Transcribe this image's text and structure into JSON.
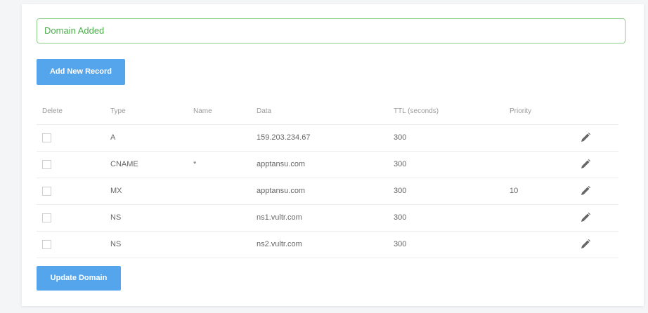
{
  "alert": {
    "text": "Domain Added"
  },
  "buttons": {
    "add_record": "Add New Record",
    "update_domain": "Update Domain"
  },
  "table": {
    "headers": {
      "delete": "Delete",
      "type": "Type",
      "name": "Name",
      "data": "Data",
      "ttl": "TTL (seconds)",
      "priority": "Priority"
    },
    "rows": [
      {
        "type": "A",
        "name": "",
        "data": "159.203.234.67",
        "ttl": "300",
        "priority": ""
      },
      {
        "type": "CNAME",
        "name": "*",
        "data": "apptansu.com",
        "ttl": "300",
        "priority": ""
      },
      {
        "type": "MX",
        "name": "",
        "data": "apptansu.com",
        "ttl": "300",
        "priority": "10"
      },
      {
        "type": "NS",
        "name": "",
        "data": "ns1.vultr.com",
        "ttl": "300",
        "priority": ""
      },
      {
        "type": "NS",
        "name": "",
        "data": "ns2.vultr.com",
        "ttl": "300",
        "priority": ""
      }
    ]
  },
  "icons": {
    "edit": "pencil-icon"
  },
  "colors": {
    "accent": "#55a5ec",
    "success_border": "#8fd08f",
    "success_text": "#4cae4c"
  }
}
